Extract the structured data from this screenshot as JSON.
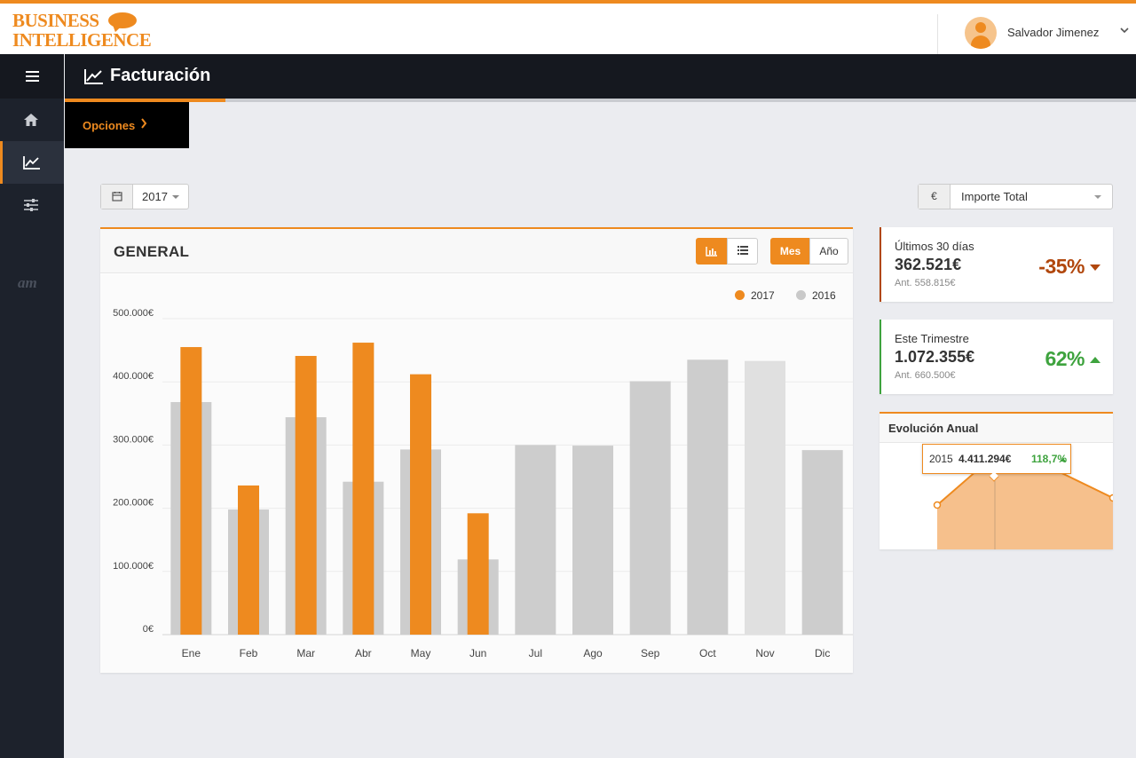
{
  "brand": {
    "line1": "BUSINESS",
    "line2": "INTELLIGENCE"
  },
  "user": {
    "name": "Salvador Jimenez"
  },
  "page": {
    "title": "Facturación",
    "options_label": "Opciones"
  },
  "filters": {
    "year": "2017",
    "currency_symbol": "€",
    "metric": "Importe Total"
  },
  "sidebar": {
    "brand_mark": "am",
    "items": [
      "home-icon",
      "chart-line-icon",
      "sliders-icon"
    ]
  },
  "panel": {
    "title": "GENERAL",
    "toggle_month": "Mes",
    "toggle_year": "Año"
  },
  "kpis": [
    {
      "label": "Últimos 30 días",
      "value": "362.521€",
      "previous": "Ant. 558.815€",
      "change": "-35%",
      "direction": "down",
      "color": "#b1470d"
    },
    {
      "label": "Este Trimestre",
      "value": "1.072.355€",
      "previous": "Ant. 660.500€",
      "change": "62%",
      "direction": "up",
      "color": "#3ea33e"
    }
  ],
  "evolution": {
    "title": "Evolución Anual",
    "tooltip": {
      "year": "2015",
      "value": "4.411.294€",
      "change": "118,7%"
    },
    "values": [
      3000000,
      4411294,
      4000000,
      3200000
    ]
  },
  "colors": {
    "accent": "#ee8a1f",
    "series_2016": "#c9c9c9"
  },
  "chart_data": {
    "type": "bar",
    "categories": [
      "Ene",
      "Feb",
      "Mar",
      "Abr",
      "May",
      "Jun",
      "Jul",
      "Ago",
      "Sep",
      "Oct",
      "Nov",
      "Dic"
    ],
    "series": [
      {
        "name": "2017",
        "values": [
          455000,
          236000,
          441000,
          462000,
          412000,
          192000,
          null,
          null,
          null,
          null,
          null,
          null
        ]
      },
      {
        "name": "2016",
        "values": [
          368000,
          198000,
          344000,
          242000,
          293000,
          119000,
          300000,
          299000,
          401000,
          435000,
          433000,
          292000
        ]
      }
    ],
    "yticks": [
      "0€",
      "100.000€",
      "200.000€",
      "300.000€",
      "400.000€",
      "500.000€"
    ],
    "ylim": [
      0,
      500000
    ],
    "legend": "top-right",
    "grid": true
  }
}
